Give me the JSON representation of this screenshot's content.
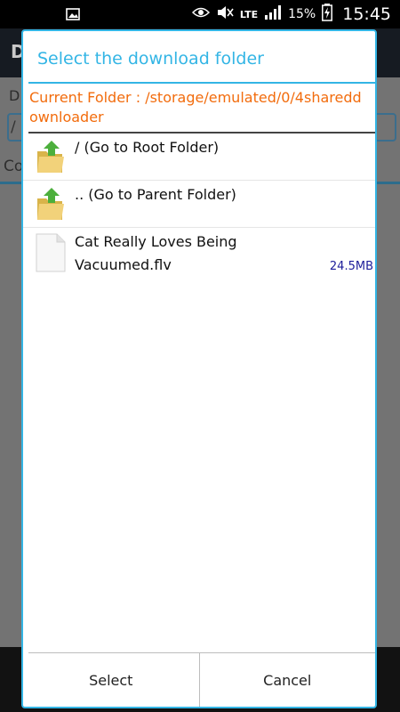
{
  "statusbar": {
    "network": "LTE",
    "battery": "15%",
    "time": "15:45"
  },
  "background_app": {
    "title": "D",
    "label": "D",
    "input_value": "/",
    "tab_label": "Co"
  },
  "dialog": {
    "title": "Select the download folder",
    "current_folder_prefix": "Current Folder : ",
    "current_folder_path": "/storage/emulated/0/4shareddownloader",
    "items": [
      {
        "name": "/ (Go to Root Folder)",
        "type": "folder",
        "size": ""
      },
      {
        "name": ".. (Go to Parent Folder)",
        "type": "folder",
        "size": ""
      },
      {
        "name": "Cat Really Loves Being Vacuumed.flv",
        "type": "file",
        "size": "24.5MB"
      }
    ],
    "buttons": {
      "select": "Select",
      "cancel": "Cancel"
    }
  },
  "colors": {
    "accent": "#33b5e5",
    "current_folder": "#f26c0d",
    "file_size": "#1c1c9a"
  }
}
